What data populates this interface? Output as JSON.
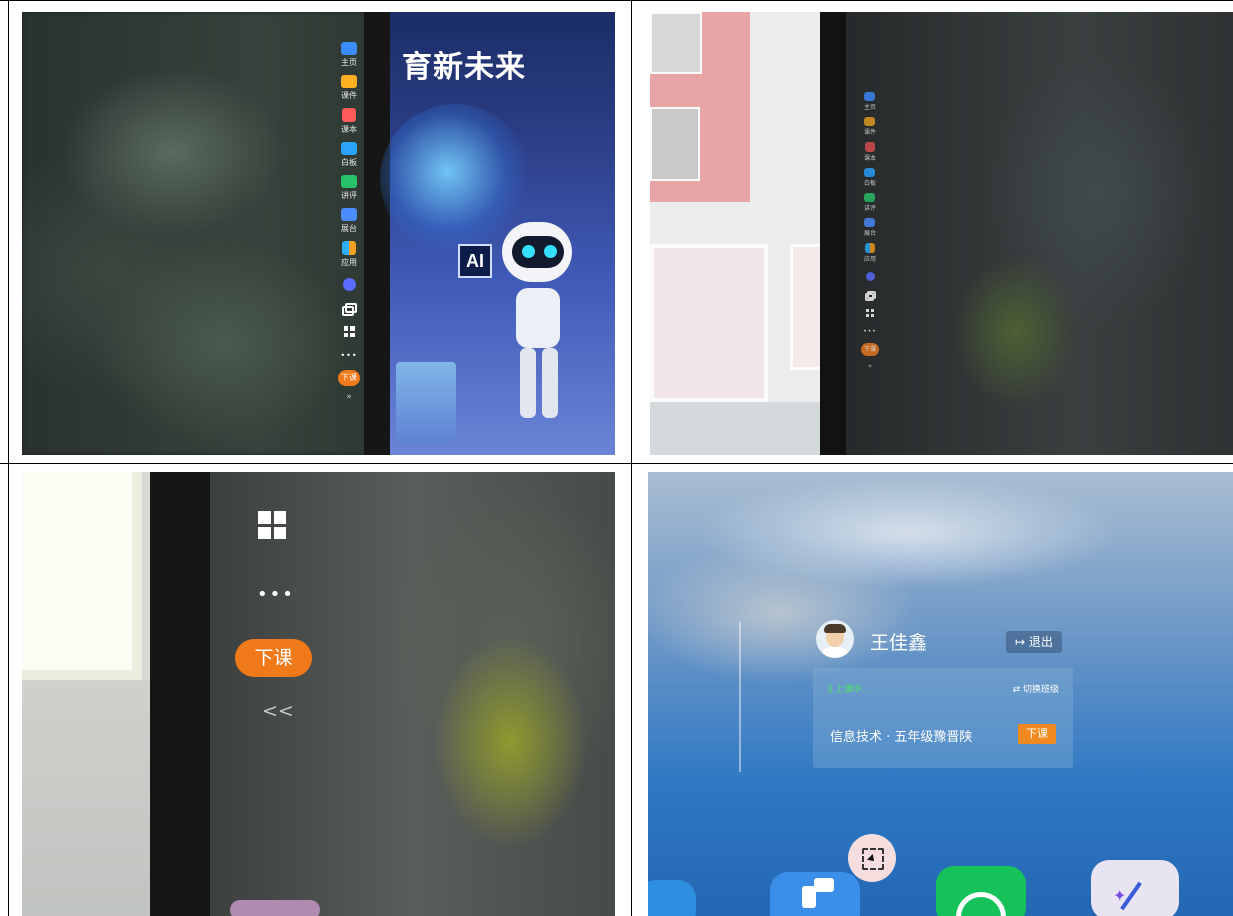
{
  "panel1": {
    "poster_headline": "育新未来",
    "poster_sign": "AI",
    "sidebar_items": [
      {
        "label": "主页",
        "icon": "home-icon",
        "color": "#3b8cff"
      },
      {
        "label": "课件",
        "icon": "folder-icon",
        "color": "#ffb020"
      },
      {
        "label": "课本",
        "icon": "book-icon",
        "color": "#ff5a5a"
      },
      {
        "label": "白板",
        "icon": "whiteboard-icon",
        "color": "#2aa3ff"
      },
      {
        "label": "讲评",
        "icon": "review-icon",
        "color": "#27c36a"
      },
      {
        "label": "展台",
        "icon": "booth-icon",
        "color": "#4a8cff"
      },
      {
        "label": "应用",
        "icon": "apps-icon",
        "color": "#f2a020"
      }
    ],
    "more_label": "•••",
    "end_class_label": "下课",
    "collapse_label": "»"
  },
  "panel2": {
    "sidebar_items": [
      "主页",
      "课件",
      "课本",
      "白板",
      "讲评",
      "展台",
      "应用"
    ],
    "more_label": "•••",
    "end_class_label": "下课",
    "collapse_label": "«"
  },
  "panel3": {
    "more_label": "•••",
    "end_class_label": "下课",
    "collapse_label": "<<"
  },
  "panel4": {
    "user_name": "王佳鑫",
    "logout_label": "↦ 退出",
    "status_label": "⫼ 上课中...",
    "switch_class_label": "⇄ 切换班级",
    "course_label": "信息技术 · 五年级豫晋陕",
    "end_class_label": "下课",
    "colors": {
      "status": "#4ee06a",
      "accent": "#f08a20"
    }
  }
}
